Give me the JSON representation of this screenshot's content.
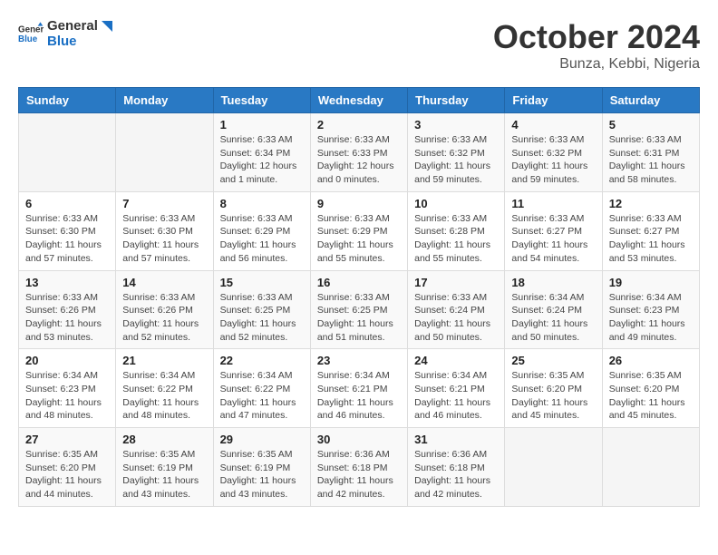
{
  "header": {
    "logo_general": "General",
    "logo_blue": "Blue",
    "month": "October 2024",
    "location": "Bunza, Kebbi, Nigeria"
  },
  "weekdays": [
    "Sunday",
    "Monday",
    "Tuesday",
    "Wednesday",
    "Thursday",
    "Friday",
    "Saturday"
  ],
  "weeks": [
    [
      {
        "day": null
      },
      {
        "day": null
      },
      {
        "day": "1",
        "sunrise": "6:33 AM",
        "sunset": "6:34 PM",
        "daylight": "12 hours and 1 minute."
      },
      {
        "day": "2",
        "sunrise": "6:33 AM",
        "sunset": "6:33 PM",
        "daylight": "12 hours and 0 minutes."
      },
      {
        "day": "3",
        "sunrise": "6:33 AM",
        "sunset": "6:32 PM",
        "daylight": "11 hours and 59 minutes."
      },
      {
        "day": "4",
        "sunrise": "6:33 AM",
        "sunset": "6:32 PM",
        "daylight": "11 hours and 59 minutes."
      },
      {
        "day": "5",
        "sunrise": "6:33 AM",
        "sunset": "6:31 PM",
        "daylight": "11 hours and 58 minutes."
      }
    ],
    [
      {
        "day": "6",
        "sunrise": "6:33 AM",
        "sunset": "6:30 PM",
        "daylight": "11 hours and 57 minutes."
      },
      {
        "day": "7",
        "sunrise": "6:33 AM",
        "sunset": "6:30 PM",
        "daylight": "11 hours and 57 minutes."
      },
      {
        "day": "8",
        "sunrise": "6:33 AM",
        "sunset": "6:29 PM",
        "daylight": "11 hours and 56 minutes."
      },
      {
        "day": "9",
        "sunrise": "6:33 AM",
        "sunset": "6:29 PM",
        "daylight": "11 hours and 55 minutes."
      },
      {
        "day": "10",
        "sunrise": "6:33 AM",
        "sunset": "6:28 PM",
        "daylight": "11 hours and 55 minutes."
      },
      {
        "day": "11",
        "sunrise": "6:33 AM",
        "sunset": "6:27 PM",
        "daylight": "11 hours and 54 minutes."
      },
      {
        "day": "12",
        "sunrise": "6:33 AM",
        "sunset": "6:27 PM",
        "daylight": "11 hours and 53 minutes."
      }
    ],
    [
      {
        "day": "13",
        "sunrise": "6:33 AM",
        "sunset": "6:26 PM",
        "daylight": "11 hours and 53 minutes."
      },
      {
        "day": "14",
        "sunrise": "6:33 AM",
        "sunset": "6:26 PM",
        "daylight": "11 hours and 52 minutes."
      },
      {
        "day": "15",
        "sunrise": "6:33 AM",
        "sunset": "6:25 PM",
        "daylight": "11 hours and 52 minutes."
      },
      {
        "day": "16",
        "sunrise": "6:33 AM",
        "sunset": "6:25 PM",
        "daylight": "11 hours and 51 minutes."
      },
      {
        "day": "17",
        "sunrise": "6:33 AM",
        "sunset": "6:24 PM",
        "daylight": "11 hours and 50 minutes."
      },
      {
        "day": "18",
        "sunrise": "6:34 AM",
        "sunset": "6:24 PM",
        "daylight": "11 hours and 50 minutes."
      },
      {
        "day": "19",
        "sunrise": "6:34 AM",
        "sunset": "6:23 PM",
        "daylight": "11 hours and 49 minutes."
      }
    ],
    [
      {
        "day": "20",
        "sunrise": "6:34 AM",
        "sunset": "6:23 PM",
        "daylight": "11 hours and 48 minutes."
      },
      {
        "day": "21",
        "sunrise": "6:34 AM",
        "sunset": "6:22 PM",
        "daylight": "11 hours and 48 minutes."
      },
      {
        "day": "22",
        "sunrise": "6:34 AM",
        "sunset": "6:22 PM",
        "daylight": "11 hours and 47 minutes."
      },
      {
        "day": "23",
        "sunrise": "6:34 AM",
        "sunset": "6:21 PM",
        "daylight": "11 hours and 46 minutes."
      },
      {
        "day": "24",
        "sunrise": "6:34 AM",
        "sunset": "6:21 PM",
        "daylight": "11 hours and 46 minutes."
      },
      {
        "day": "25",
        "sunrise": "6:35 AM",
        "sunset": "6:20 PM",
        "daylight": "11 hours and 45 minutes."
      },
      {
        "day": "26",
        "sunrise": "6:35 AM",
        "sunset": "6:20 PM",
        "daylight": "11 hours and 45 minutes."
      }
    ],
    [
      {
        "day": "27",
        "sunrise": "6:35 AM",
        "sunset": "6:20 PM",
        "daylight": "11 hours and 44 minutes."
      },
      {
        "day": "28",
        "sunrise": "6:35 AM",
        "sunset": "6:19 PM",
        "daylight": "11 hours and 43 minutes."
      },
      {
        "day": "29",
        "sunrise": "6:35 AM",
        "sunset": "6:19 PM",
        "daylight": "11 hours and 43 minutes."
      },
      {
        "day": "30",
        "sunrise": "6:36 AM",
        "sunset": "6:18 PM",
        "daylight": "11 hours and 42 minutes."
      },
      {
        "day": "31",
        "sunrise": "6:36 AM",
        "sunset": "6:18 PM",
        "daylight": "11 hours and 42 minutes."
      },
      {
        "day": null
      },
      {
        "day": null
      }
    ]
  ]
}
